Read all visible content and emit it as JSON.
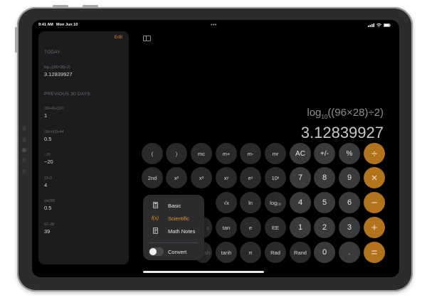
{
  "status_bar": {
    "time": "9:41 AM",
    "date": "Mon Jun 10"
  },
  "toolbar": {
    "more": "•••"
  },
  "history": {
    "edit_label": "Edit",
    "today_title": "TODAY",
    "today_items": [
      {
        "expr": "log₁₀((96×28)÷2)",
        "result": "3.12839927"
      }
    ],
    "previous_title": "PREVIOUS 30 DAYS",
    "previous_items": [
      {
        "expr": "(36+4)÷(12²)",
        "result": "1"
      },
      {
        "expr": "(16²+52)÷44",
        "result": "0.5"
      },
      {
        "expr": "−20",
        "result": "−20"
      },
      {
        "expr": "12÷3",
        "result": "4"
      },
      {
        "expr": "sin(30)",
        "result": "0.5"
      },
      {
        "expr": "67−28",
        "result": "39"
      }
    ]
  },
  "display": {
    "expression": "log10((96×28)÷2)",
    "result": "3.12839927"
  },
  "keypad": {
    "row1": [
      "(",
      ")",
      "mc",
      "m+",
      "m-",
      "mr",
      "AC",
      "+/-",
      "%",
      "÷"
    ],
    "row2": [
      "2nd",
      "x²",
      "x³",
      "xʸ",
      "eˣ",
      "10ˣ",
      "7",
      "8",
      "9",
      "×"
    ],
    "row3": [
      "√x",
      "ln",
      "log₁₀",
      "4",
      "5",
      "6",
      "−"
    ],
    "row4": [
      "s",
      "tan",
      "e",
      "EE",
      "1",
      "2",
      "3",
      "+"
    ],
    "row5": [
      "sh",
      "tanh",
      "π",
      "Rad",
      "Rand",
      "0",
      ".",
      "="
    ]
  },
  "mode_menu": {
    "items": [
      {
        "label": "Basic",
        "icon": "calculator-icon"
      },
      {
        "label": "Scientific",
        "icon": "function-icon"
      },
      {
        "label": "Math Notes",
        "icon": "notes-icon"
      }
    ],
    "selected": "Scientific",
    "convert_label": "Convert",
    "convert_on": false
  },
  "colors": {
    "accent": "#b1731c",
    "selected_menu": "#e0922c",
    "background": "#000000"
  }
}
